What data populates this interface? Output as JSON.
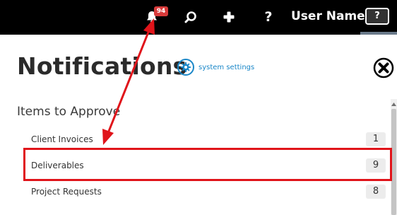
{
  "header": {
    "notification_count": "94",
    "help_glyph": "?",
    "user_name": "User Name",
    "help_box_glyph": "?"
  },
  "page": {
    "title": "Notifications",
    "settings_label": "system settings"
  },
  "approvals": {
    "section_title": "Items to Approve",
    "items": [
      {
        "label": "Client Invoices",
        "count": "1"
      },
      {
        "label": "Deliverables",
        "count": "9"
      },
      {
        "label": "Project Requests",
        "count": "8"
      }
    ]
  },
  "annotation": {
    "color": "#e0141a"
  },
  "colors": {
    "topbar": "#000000",
    "badge": "#d73a3a",
    "link": "#1a87c8"
  }
}
